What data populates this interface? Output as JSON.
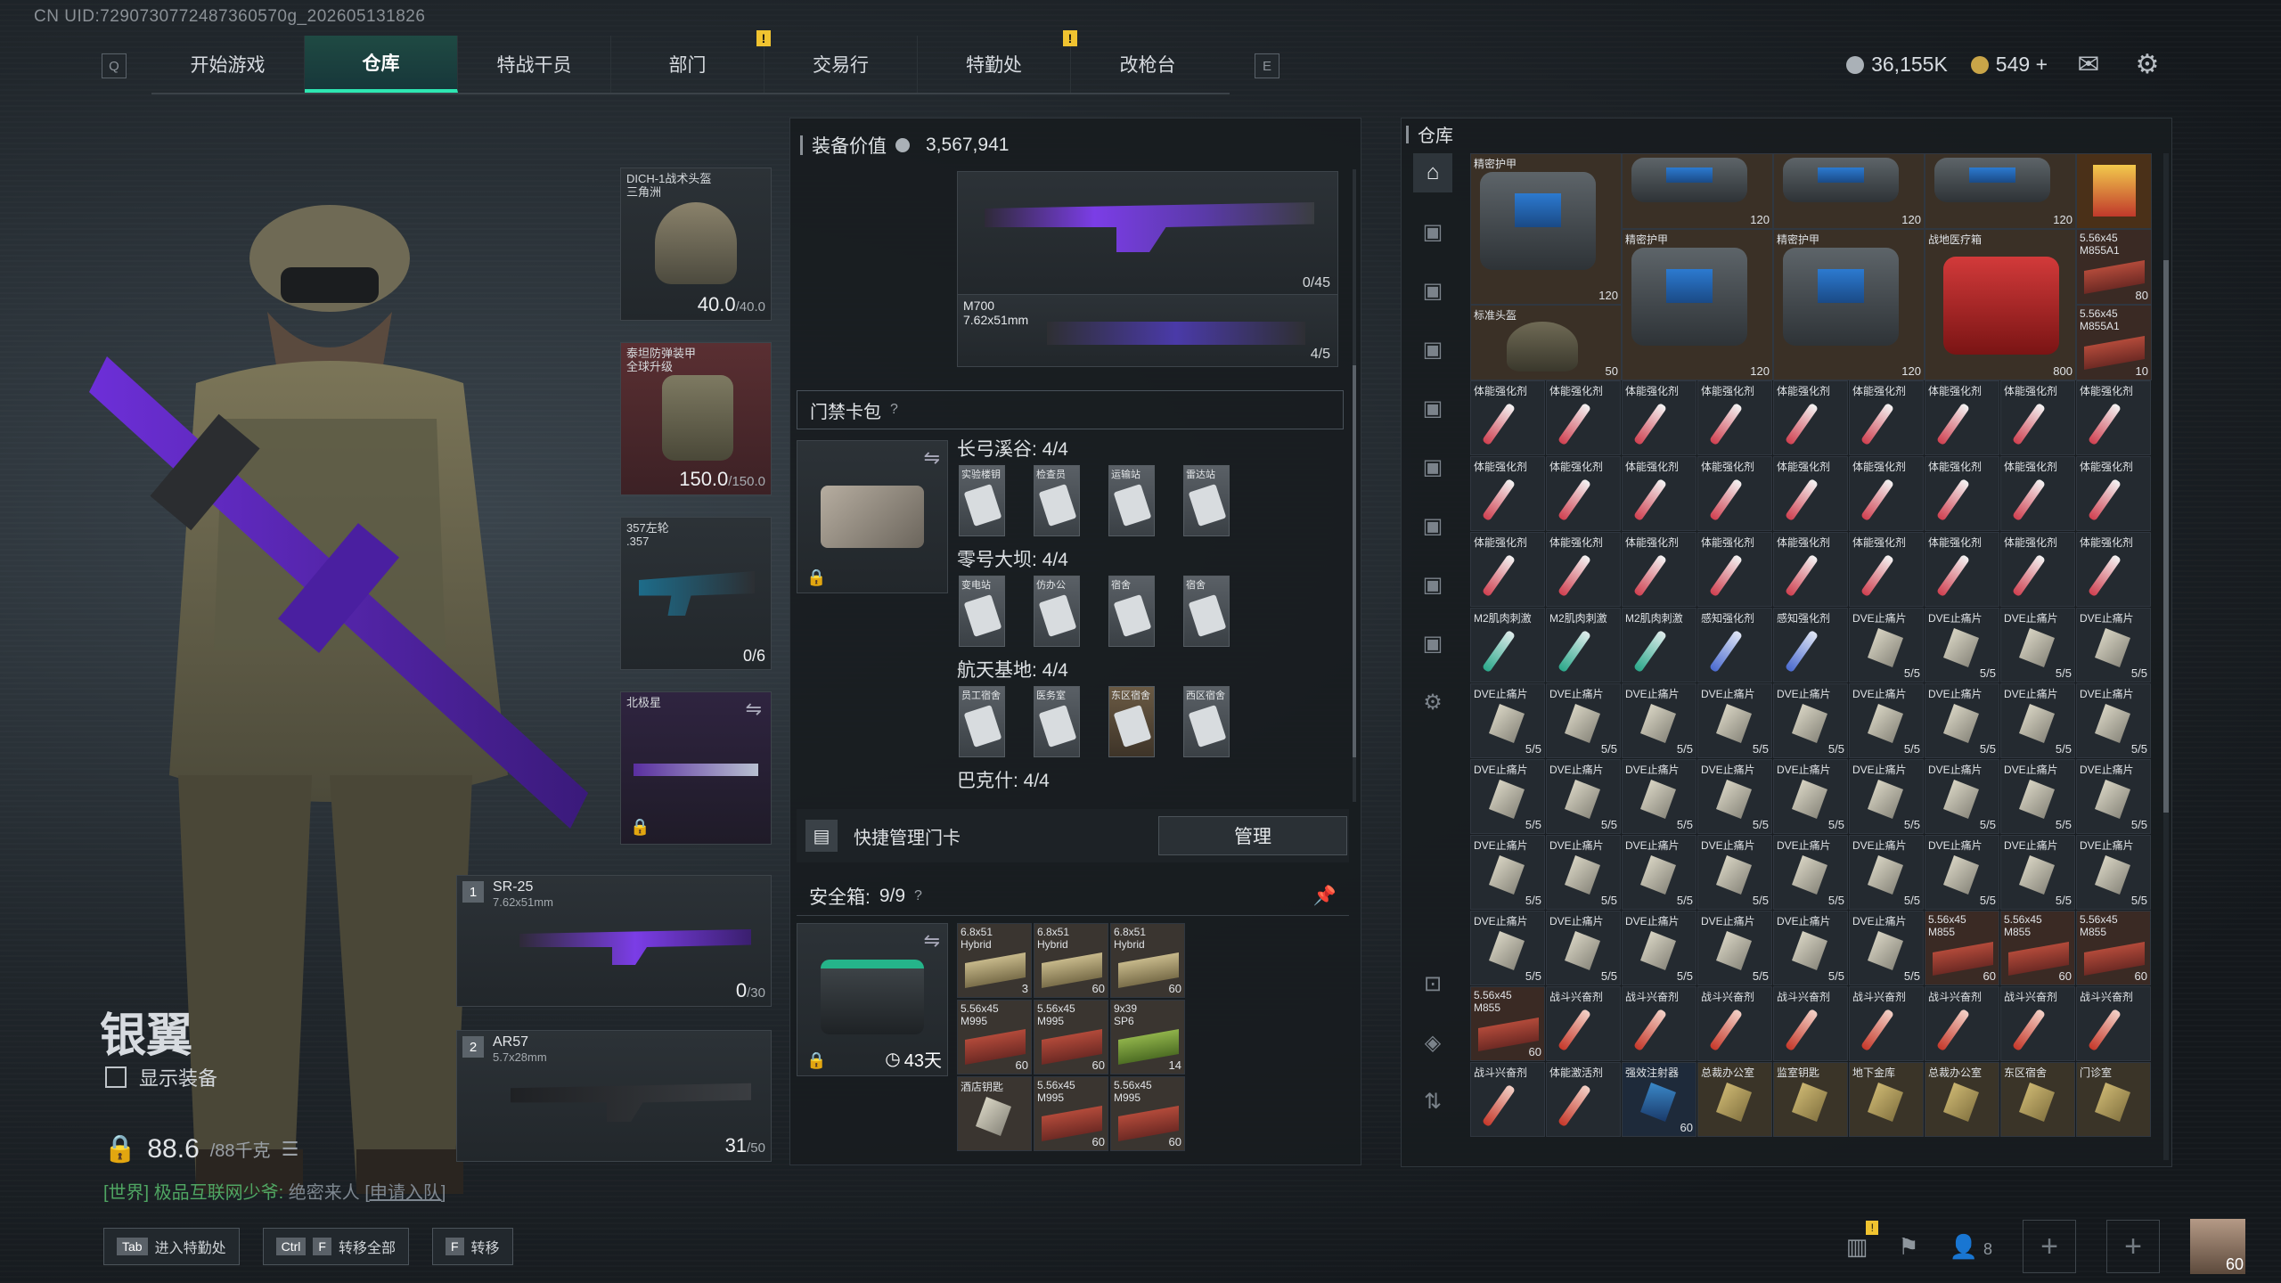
{
  "header": {
    "uid": "CN UID:7290730772487360570g_202605131826",
    "key_left": "Q",
    "key_right": "E",
    "tabs": [
      {
        "label": "开始游戏"
      },
      {
        "label": "仓库",
        "active": true
      },
      {
        "label": "特战干员"
      },
      {
        "label": "部门"
      },
      {
        "label": "交易行"
      },
      {
        "label": "特勤处"
      },
      {
        "label": "改枪台"
      }
    ],
    "warn_mark": "!",
    "currency1": "36,155K",
    "currency2": "549",
    "add_label": "+"
  },
  "character": {
    "name": "银翼",
    "show_equipment": "显示装备",
    "weight": "88.6",
    "weight_max": "/88千克",
    "world_chat_channel": "[世界] 极品互联网少爷:",
    "world_chat_msg": "绝密来人",
    "world_chat_action": "[申请入队]"
  },
  "equipment": {
    "helmet": {
      "label": "DICH-1战术头盔\n三角洲",
      "value": "40.0",
      "max": "/40.0"
    },
    "armor": {
      "label": "泰坦防弹装甲\n全球升级",
      "value": "150.0",
      "max": "/150.0"
    },
    "pistol": {
      "label": "357左轮\n.357",
      "ammo": "0/6"
    },
    "melee": {
      "label": "北极星"
    },
    "primary1": {
      "slot": "1",
      "name": "SR-25",
      "caliber": "7.62x51mm",
      "ammo": "0",
      "ammo_max": "/30"
    },
    "primary2": {
      "slot": "2",
      "name": "AR57",
      "caliber": "5.7x28mm",
      "ammo": "31",
      "ammo_max": "/50"
    }
  },
  "loadout": {
    "title": "装备价值",
    "value": "3,567,941",
    "rifle_count": "0/45",
    "sniper_name": "M700",
    "sniper_caliber": "7.62x51mm",
    "sniper_count": "4/5"
  },
  "keycards": {
    "title": "门禁卡包",
    "help": "?",
    "groups": [
      {
        "name": "长弓溪谷: 4/4",
        "cards": [
          "实验楼钥",
          "检查员",
          "运输站",
          "雷达站"
        ]
      },
      {
        "name": "零号大坝: 4/4",
        "cards": [
          "变电站",
          "仿办公",
          "宿舍",
          "宿舍"
        ]
      },
      {
        "name": "航天基地: 4/4",
        "cards": [
          "员工宿舍",
          "医务室",
          "东区宿舍",
          "西区宿舍"
        ]
      },
      {
        "name": "巴克什: 4/4",
        "cards": []
      }
    ],
    "quick_manage": "快捷管理门卡",
    "manage_btn": "管理"
  },
  "safebox": {
    "title": "安全箱:",
    "count": "9/9",
    "help": "?",
    "days": "43天",
    "items": [
      {
        "t": "6.8x51\nHybrid",
        "n": "3",
        "k": "t2"
      },
      {
        "t": "6.8x51\nHybrid",
        "n": "60",
        "k": "t2"
      },
      {
        "t": "6.8x51\nHybrid",
        "n": "60",
        "k": "t2"
      },
      {
        "t": "5.56x45\nM995",
        "n": "60",
        "k": "r"
      },
      {
        "t": "5.56x45\nM995",
        "n": "60",
        "k": "r"
      },
      {
        "t": "9x39\nSP6",
        "n": "14",
        "k": "g2"
      },
      {
        "t": "酒店钥匙",
        "n": "",
        "k": "card"
      },
      {
        "t": "5.56x45\nM995",
        "n": "60",
        "k": "r"
      },
      {
        "t": "5.56x45\nM995",
        "n": "60",
        "k": "r"
      }
    ]
  },
  "warehouse": {
    "title": "仓库",
    "top_items": [
      {
        "t": "精密护甲",
        "n": "120"
      },
      {
        "t": "",
        "n": "120"
      },
      {
        "t": "",
        "n": "120"
      },
      {
        "t": "",
        "n": "120"
      },
      {
        "t": "精密护甲",
        "n": "120"
      },
      {
        "t": "精密护甲",
        "n": "120"
      },
      {
        "t": "战地医疗箱",
        "n": "800"
      },
      {
        "t": "标准头盔",
        "n": "50"
      },
      {
        "t": "5.56x45\nM855A1",
        "n": "80"
      },
      {
        "t": "5.56x45\nM855A1",
        "n": "10"
      }
    ],
    "rows": [
      [
        "体能强化剂",
        "体能强化剂",
        "体能强化剂",
        "体能强化剂",
        "体能强化剂",
        "体能强化剂",
        "体能强化剂",
        "体能强化剂",
        "体能强化剂"
      ],
      [
        "体能强化剂",
        "体能强化剂",
        "体能强化剂",
        "体能强化剂",
        "体能强化剂",
        "体能强化剂",
        "体能强化剂",
        "体能强化剂",
        "体能强化剂"
      ],
      [
        "体能强化剂",
        "体能强化剂",
        "体能强化剂",
        "体能强化剂",
        "体能强化剂",
        "体能强化剂",
        "体能强化剂",
        "体能强化剂",
        "体能强化剂"
      ],
      [
        "M2肌肉刺激",
        "M2肌肉刺激",
        "M2肌肉刺激",
        "感知强化剂",
        "感知强化剂",
        "DVE止痛片",
        "DVE止痛片",
        "DVE止痛片",
        "DVE止痛片"
      ],
      [
        "DVE止痛片",
        "DVE止痛片",
        "DVE止痛片",
        "DVE止痛片",
        "DVE止痛片",
        "DVE止痛片",
        "DVE止痛片",
        "DVE止痛片",
        "DVE止痛片"
      ],
      [
        "DVE止痛片",
        "DVE止痛片",
        "DVE止痛片",
        "DVE止痛片",
        "DVE止痛片",
        "DVE止痛片",
        "DVE止痛片",
        "DVE止痛片",
        "DVE止痛片"
      ],
      [
        "DVE止痛片",
        "DVE止痛片",
        "DVE止痛片",
        "DVE止痛片",
        "DVE止痛片",
        "DVE止痛片",
        "DVE止痛片",
        "DVE止痛片",
        "DVE止痛片"
      ],
      [
        "DVE止痛片",
        "DVE止痛片",
        "DVE止痛片",
        "DVE止痛片",
        "DVE止痛片",
        "DVE止痛片",
        "5.56x45\nM855",
        "5.56x45\nM855",
        "5.56x45\nM855"
      ],
      [
        "5.56x45\nM855",
        "战斗兴奋剂",
        "战斗兴奋剂",
        "战斗兴奋剂",
        "战斗兴奋剂",
        "战斗兴奋剂",
        "战斗兴奋剂",
        "战斗兴奋剂",
        "战斗兴奋剂"
      ],
      [
        "战斗兴奋剂",
        "体能激活剂",
        "强效注射器",
        "总裁办公室",
        "监室钥匙",
        "地下金库",
        "总裁办公室",
        "东区宿舍",
        "门诊室"
      ]
    ],
    "counts": {
      "pill": "5/5",
      "ammo": "60",
      "stim_plus": "60"
    }
  },
  "bottom": {
    "k1": "Tab",
    "l1": "进入特勤处",
    "k2a": "Ctrl",
    "k2b": "F",
    "l2": "转移全部",
    "k3": "F",
    "l3": "转移",
    "friends": "8",
    "level": "60"
  }
}
